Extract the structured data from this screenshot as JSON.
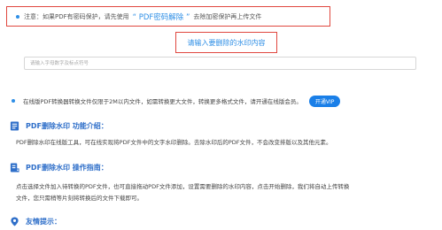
{
  "notice": {
    "prefix": "注意：如果PDF有密码保护，请先使用",
    "link": "“ PDF密码解除 ”",
    "suffix": "去除加密保护再上传文件"
  },
  "watermark": {
    "title": "请输入要删除的水印内容",
    "input_placeholder": "请输入字母数字及标点符号",
    "input_value": ""
  },
  "limit_notice": {
    "text": "在线版PDF转换器转换文件仅限于2M以内文件，如需转换更大文件，转换更多格式文件，请开通在线版会员。",
    "vip_button": "开通VIP"
  },
  "intro": {
    "title": "PDF删除水印 功能介绍：",
    "text": "PDF删除水印在线版工具，可在线实现将PDF文件中的文字水印删除。去除水印后的PDF文件，不会改变排版以及其他元素。"
  },
  "guide": {
    "title": "PDF删除水印 操作指南：",
    "lines": [
      "点击选择文件加入待转换的PDF文件，也可直接拖动PDF文件添加，设置需要删除的水印内容，点击开始删除，我们将自动上传转换",
      "文件，您只需稍等片刻将转换后的文件下载即可。"
    ]
  },
  "tips": {
    "title": "友情提示："
  },
  "colors": {
    "accent": "#2f8fe6",
    "heading": "#2f6fc9",
    "highlight_border": "#e0473f",
    "vip_button": "#1a7fe8"
  },
  "icons": {
    "intro": "document-icon",
    "guide": "guide-document-icon",
    "tips": "location-pin-icon"
  }
}
